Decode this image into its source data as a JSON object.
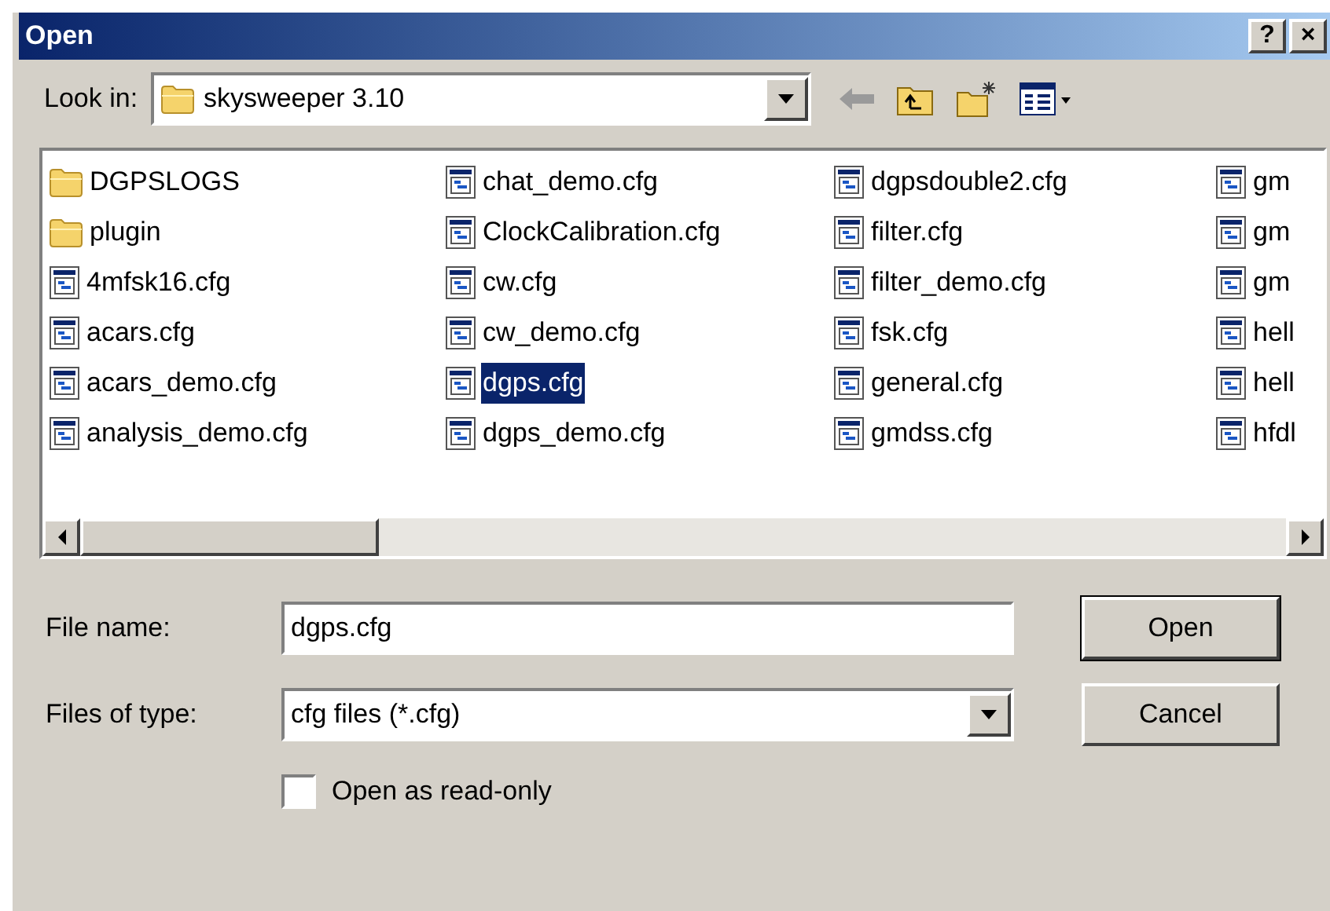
{
  "window": {
    "title": "Open",
    "buttons": [
      "?",
      "×"
    ]
  },
  "look_in": {
    "label": "Look in:",
    "value": "skysweeper 3.10"
  },
  "files": [
    {
      "name": "DGPSLOGS",
      "kind": "folder",
      "selected": false
    },
    {
      "name": "plugin",
      "kind": "folder",
      "selected": false
    },
    {
      "name": "4mfsk16.cfg",
      "kind": "file",
      "selected": false
    },
    {
      "name": "acars.cfg",
      "kind": "file",
      "selected": false
    },
    {
      "name": "acars_demo.cfg",
      "kind": "file",
      "selected": false
    },
    {
      "name": "analysis_demo.cfg",
      "kind": "file",
      "selected": false
    },
    {
      "name": "chat_demo.cfg",
      "kind": "file",
      "selected": false
    },
    {
      "name": "ClockCalibration.cfg",
      "kind": "file",
      "selected": false
    },
    {
      "name": "cw.cfg",
      "kind": "file",
      "selected": false
    },
    {
      "name": "cw_demo.cfg",
      "kind": "file",
      "selected": false
    },
    {
      "name": "dgps.cfg",
      "kind": "file",
      "selected": true
    },
    {
      "name": "dgps_demo.cfg",
      "kind": "file",
      "selected": false
    },
    {
      "name": "dgpsdouble2.cfg",
      "kind": "file",
      "selected": false
    },
    {
      "name": "filter.cfg",
      "kind": "file",
      "selected": false
    },
    {
      "name": "filter_demo.cfg",
      "kind": "file",
      "selected": false
    },
    {
      "name": "fsk.cfg",
      "kind": "file",
      "selected": false
    },
    {
      "name": "general.cfg",
      "kind": "file",
      "selected": false
    },
    {
      "name": "gmdss.cfg",
      "kind": "file",
      "selected": false
    },
    {
      "name": "gm",
      "kind": "file",
      "selected": false
    },
    {
      "name": "gm",
      "kind": "file",
      "selected": false
    },
    {
      "name": "gm",
      "kind": "file",
      "selected": false
    },
    {
      "name": "hell",
      "kind": "file",
      "selected": false
    },
    {
      "name": "hell",
      "kind": "file",
      "selected": false
    },
    {
      "name": "hfdl",
      "kind": "file",
      "selected": false
    }
  ],
  "file_name": {
    "label": "File name:",
    "value": "dgps.cfg"
  },
  "file_type": {
    "label": "Files of type:",
    "value": "cfg files (*.cfg)"
  },
  "read_only": {
    "label": "Open as read-only",
    "checked": false
  },
  "buttons": [
    "Open",
    "Cancel"
  ]
}
